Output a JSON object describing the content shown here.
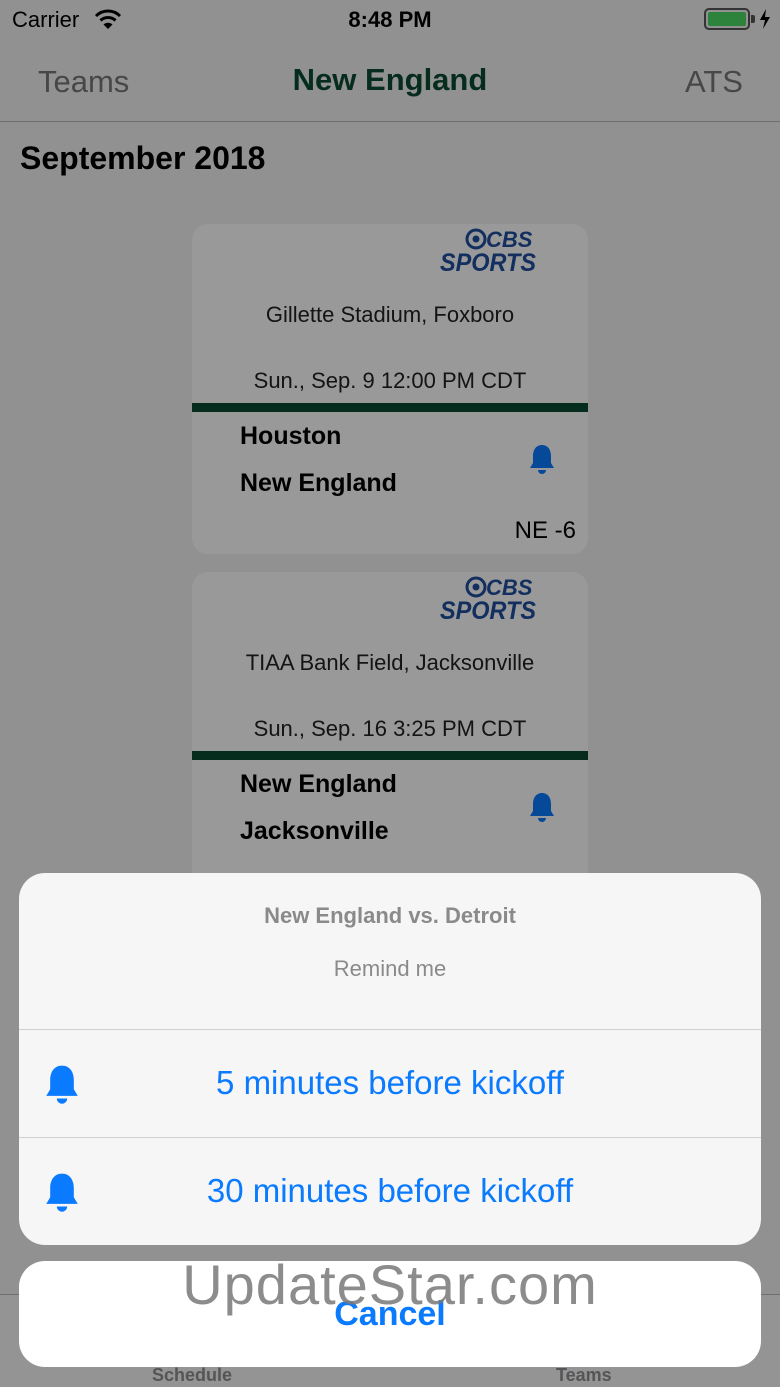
{
  "status_bar": {
    "carrier": "Carrier",
    "time": "8:48 PM"
  },
  "nav": {
    "left": "Teams",
    "title": "New England",
    "right": "ATS"
  },
  "section_title": "September 2018",
  "games": [
    {
      "network": "CBS SPORTS",
      "venue": "Gillette Stadium, Foxboro",
      "date": "Sun., Sep. 9 12:00 PM CDT",
      "away": "Houston",
      "home": "New England",
      "spread": "NE -6"
    },
    {
      "network": "CBS SPORTS",
      "venue": "TIAA Bank Field, Jacksonville",
      "date": "Sun., Sep. 16 3:25 PM CDT",
      "away": "New England",
      "home": "Jacksonville",
      "spread": ""
    }
  ],
  "tabs": [
    {
      "label": "Schedule"
    },
    {
      "label": "Teams"
    }
  ],
  "action_sheet": {
    "title": "New England vs. Detroit",
    "message": "Remind me",
    "actions": [
      {
        "label": "5 minutes before kickoff",
        "icon": "bell-icon"
      },
      {
        "label": "30 minutes before kickoff",
        "icon": "bell-icon"
      }
    ],
    "cancel": "Cancel"
  },
  "watermark": "UpdateStar.com",
  "colors": {
    "team_green": "#0b4a33",
    "ios_blue": "#0a7aff",
    "cbs_blue": "#1f4f9e"
  }
}
